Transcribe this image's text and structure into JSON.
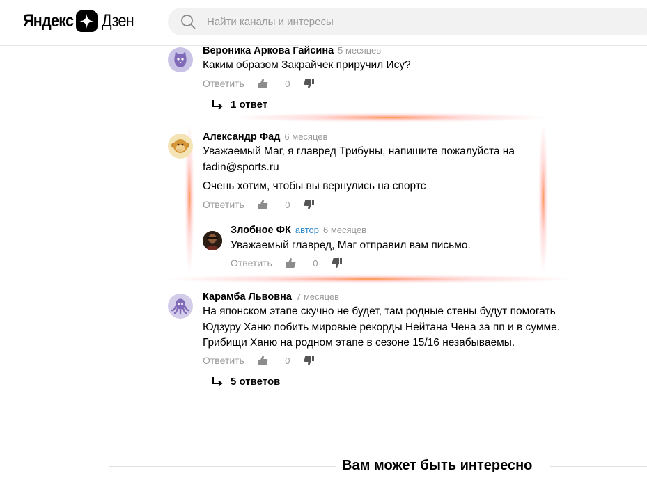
{
  "header": {
    "logo_word1": "Яндекс",
    "logo_word2": "Дзен",
    "search_placeholder": "Найти каналы и интересы"
  },
  "comments": [
    {
      "author": "Вероника Аркова Гайсина",
      "time": "5 месяцев",
      "text": "Каким образом Закрайчек приручил Ису?",
      "reply_label": "Ответить",
      "likes": "0",
      "replies_label": "1 ответ",
      "avatar_icon": "cat-avatar-icon"
    },
    {
      "author": "Александр Фад",
      "time": "6 месяцев",
      "text": "Уважаемый Маг, я главред Трибуны, напишите пожалуйста на fadin@sports.ru",
      "text2": "Очень хотим, чтобы вы вернулись на спортс",
      "reply_label": "Ответить",
      "likes": "0",
      "avatar_icon": "monkey-avatar-icon",
      "reply": {
        "author": "Злобное ФК",
        "badge": "автор",
        "time": "6 месяцев",
        "text": "Уважаемый главред, Маг отправил вам письмо.",
        "reply_label": "Ответить",
        "likes": "0"
      }
    },
    {
      "author": "Карамба Львовна",
      "time": "7 месяцев",
      "text": "На японском этапе скучно не будет, там родные стены будут помогать Юдзуру Ханю побить мировые рекорды Нейтана Чена за пп и в сумме. Грибищи Ханю на родном этапе в сезоне 15/16 незабываемы.",
      "reply_label": "Ответить",
      "likes": "0",
      "replies_label": "5 ответов",
      "avatar_icon": "octopus-avatar-icon"
    }
  ],
  "recommendations": {
    "title": "Вам может быть интересно"
  },
  "colors": {
    "author_badge": "#2a87c9",
    "muted_text": "#999999",
    "search_bg": "#f2f2f2",
    "highlight_glow": "#ff8c28"
  }
}
